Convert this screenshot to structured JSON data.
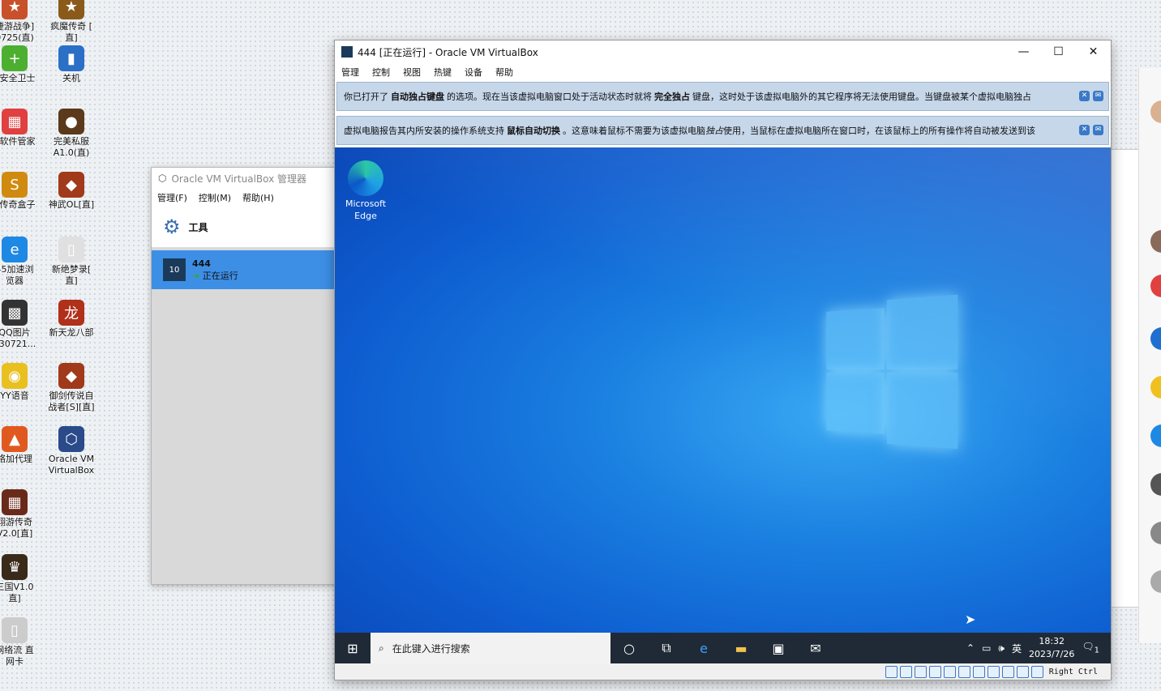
{
  "desktop_icons": [
    {
      "label": "捷游战争]\n0725(直)",
      "color": "#c8502a",
      "glyph": "★"
    },
    {
      "label": "疯魔传奇 [\n直]",
      "color": "#8a5a1a",
      "glyph": "★"
    },
    {
      "label": "0安全卫士",
      "color": "#4caf30",
      "glyph": "+"
    },
    {
      "label": "关机",
      "color": "#2b6fc7",
      "glyph": "▮"
    },
    {
      "label": "0软件管家",
      "color": "#e04040",
      "glyph": "▦"
    },
    {
      "label": "完美私服\nA1.0(直)",
      "color": "#5a3a1a",
      "glyph": "●"
    },
    {
      "label": "0传奇盒子",
      "color": "#d08a10",
      "glyph": "S"
    },
    {
      "label": "神武OL[直]",
      "color": "#a03a1a",
      "glyph": "◆"
    },
    {
      "label": "45加速浏\n览器",
      "color": "#1e88e5",
      "glyph": "e"
    },
    {
      "label": "新绝梦录[\n直]",
      "color": "#e0e0e0",
      "glyph": "▯"
    },
    {
      "label": "QQ图片\n230721...",
      "color": "#333333",
      "glyph": "▩"
    },
    {
      "label": "新天龙八部",
      "color": "#b0301a",
      "glyph": "龙"
    },
    {
      "label": "YY语音",
      "color": "#e8c020",
      "glyph": "◉"
    },
    {
      "label": "御剑传说自\n战者[S][直]",
      "color": "#a03a1a",
      "glyph": "◆"
    },
    {
      "label": "络加代理",
      "color": "#e05a20",
      "glyph": "▲"
    },
    {
      "label": "Oracle VM\nVirtualBox",
      "color": "#2a4a8a",
      "glyph": "⬡"
    },
    {
      "label": "翔游传奇\nV2.0[直]",
      "color": "#6a2a1a",
      "glyph": "▦"
    },
    {
      "label": "三国V1.0\n直]",
      "color": "#3a2a1a",
      "glyph": "♛"
    },
    {
      "label": "网络流 直\n网卡",
      "color": "#cccccc",
      "glyph": "▯"
    }
  ],
  "manager": {
    "title": "Oracle VM VirtualBox 管理器",
    "menu": [
      "管理(F)",
      "控制(M)",
      "帮助(H)"
    ],
    "tools_label": "工具",
    "vm_name": "444",
    "vm_state": "正在运行"
  },
  "vm_window": {
    "title": "444 [正在运行] - Oracle VM VirtualBox",
    "controls": [
      "—",
      "☐",
      "✕"
    ],
    "menu": [
      "管理",
      "控制",
      "视图",
      "热键",
      "设备",
      "帮助"
    ],
    "notice1": {
      "pre": "你已打开了",
      "b1": "自动独占键盘",
      "mid": "的选项。现在当该虚拟电脑窗口处于活动状态时就将",
      "b2": "完全独占",
      "post": "键盘，这时处于该虚拟电脑外的其它程序将无法使用键盘。当键盘被某个虚拟电脑独占"
    },
    "notice2": {
      "pre": "虚拟电脑报告其内所安装的操作系统支持",
      "b1": "鼠标自动切换",
      "mid": "。这意味着鼠标不需要为该虚拟电脑",
      "b2": "独占",
      "post": "使用，当鼠标在虚拟电脑所在窗口时，在该鼠标上的所有操作将自动被发送到该"
    },
    "edge_label": "Microsoft\nEdge",
    "search_placeholder": "在此键入进行搜索",
    "ime": "英",
    "time": "18:32",
    "date": "2023/7/26",
    "notify_count": "1",
    "host_key": "Right Ctrl"
  }
}
